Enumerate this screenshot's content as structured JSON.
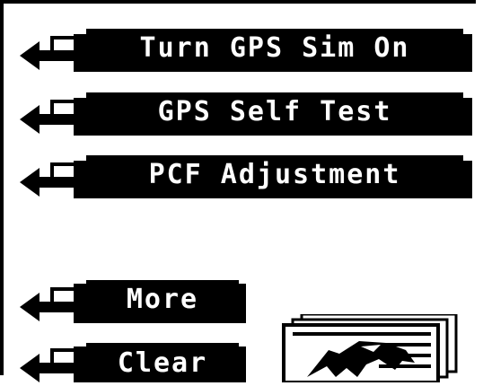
{
  "menu": {
    "items": [
      {
        "label": "Turn GPS Sim On"
      },
      {
        "label": "GPS Self Test"
      },
      {
        "label": "PCF Adjustment"
      }
    ],
    "more_label": "More",
    "clear_label": "Clear"
  },
  "icons": {
    "softkey_arrow": "left-return-arrow-icon",
    "logo": "eagle-logo-icon"
  },
  "colors": {
    "foreground": "#000000",
    "background": "#ffffff"
  }
}
